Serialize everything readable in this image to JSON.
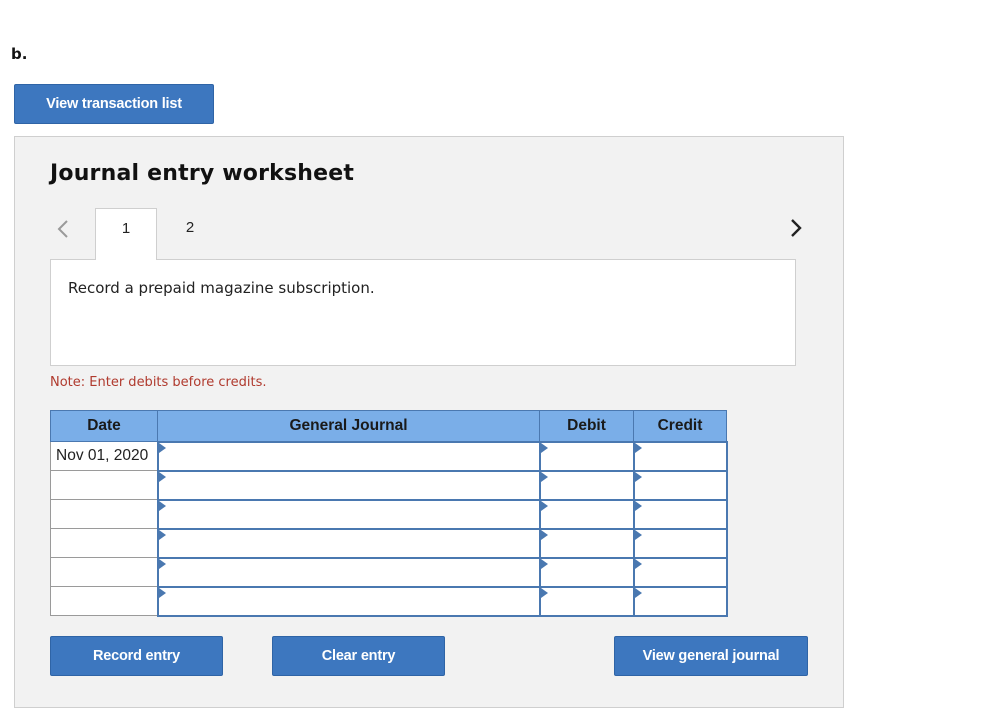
{
  "part_label": "b.",
  "top": {
    "view_transaction_list": "View transaction list"
  },
  "worksheet": {
    "title": "Journal entry worksheet",
    "tabs": [
      {
        "label": "1",
        "active": true
      },
      {
        "label": "2",
        "active": false
      }
    ],
    "description": "Record a prepaid magazine subscription.",
    "note": "Note: Enter debits before credits.",
    "table": {
      "headers": [
        "Date",
        "General Journal",
        "Debit",
        "Credit"
      ],
      "rows": [
        {
          "date": "Nov 01, 2020",
          "account": "",
          "debit": "",
          "credit": ""
        },
        {
          "date": "",
          "account": "",
          "debit": "",
          "credit": ""
        },
        {
          "date": "",
          "account": "",
          "debit": "",
          "credit": ""
        },
        {
          "date": "",
          "account": "",
          "debit": "",
          "credit": ""
        },
        {
          "date": "",
          "account": "",
          "debit": "",
          "credit": ""
        },
        {
          "date": "",
          "account": "",
          "debit": "",
          "credit": ""
        }
      ]
    },
    "buttons": {
      "record": "Record entry",
      "clear": "Clear entry",
      "view_general": "View general journal"
    },
    "icons": {
      "prev": "chevron-left-icon",
      "next": "chevron-right-icon"
    }
  },
  "colors": {
    "button_bg": "#3d77bf",
    "header_bg": "#7aaee8",
    "note_text": "#b03a2e",
    "input_border": "#4a78b0",
    "panel_bg": "#f2f2f2"
  }
}
